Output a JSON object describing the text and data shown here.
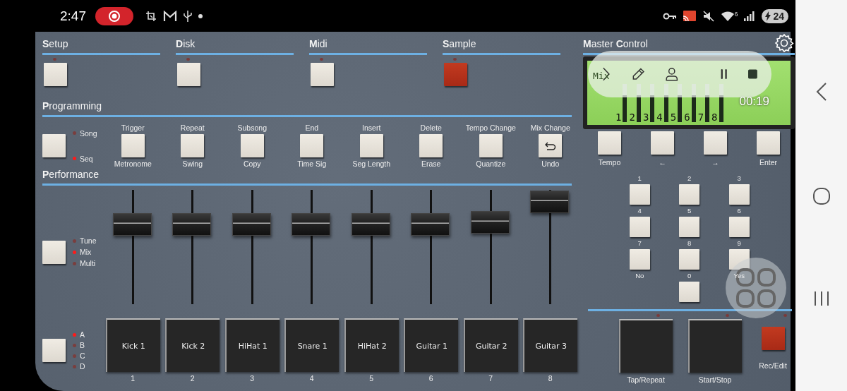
{
  "status_bar": {
    "time": "2:47",
    "wifi_badge": "6",
    "battery": "24"
  },
  "sections": [
    {
      "title": "**S**etup",
      "lit": false
    },
    {
      "title": "**D**isk",
      "lit": false
    },
    {
      "title": "**M**idi",
      "lit": false
    },
    {
      "title": "**S**ample",
      "lit": true
    }
  ],
  "programming": {
    "title": "**P**rogramming",
    "modes": [
      {
        "label": "Song",
        "selected": false
      },
      {
        "label": "Seq",
        "selected": true
      }
    ],
    "buttons": [
      {
        "top": "Trigger",
        "bottom": "Metronome",
        "kind": "plain"
      },
      {
        "top": "Repeat",
        "bottom": "Swing",
        "kind": "plain"
      },
      {
        "top": "Subsong",
        "bottom": "Copy",
        "kind": "plain"
      },
      {
        "top": "End",
        "bottom": "Time Sig",
        "kind": "plain"
      },
      {
        "top": "Insert",
        "bottom": "Seg Length",
        "kind": "plain"
      },
      {
        "top": "Delete",
        "bottom": "Erase",
        "kind": "plain"
      },
      {
        "top": "Tempo Change",
        "bottom": "Quantize",
        "kind": "plain"
      },
      {
        "top": "Mix Change",
        "bottom": "Undo",
        "kind": "undo"
      }
    ]
  },
  "performance": {
    "title": "**P**erformance",
    "modes": [
      {
        "label": "Tune",
        "selected": false
      },
      {
        "label": "Mix",
        "selected": true
      },
      {
        "label": "Multi",
        "selected": false
      }
    ],
    "faders": [
      {
        "level": 0.75
      },
      {
        "level": 0.75
      },
      {
        "level": 0.75
      },
      {
        "level": 0.75
      },
      {
        "level": 0.75
      },
      {
        "level": 0.75
      },
      {
        "level": 0.77
      },
      {
        "level": 0.99
      }
    ],
    "banks": [
      {
        "label": "A",
        "selected": true
      },
      {
        "label": "B",
        "selected": false
      },
      {
        "label": "C",
        "selected": false
      },
      {
        "label": "D",
        "selected": false
      }
    ],
    "pads": [
      {
        "name": "Kick 1",
        "number": "1"
      },
      {
        "name": "Kick 2",
        "number": "2"
      },
      {
        "name": "HiHat 1",
        "number": "3"
      },
      {
        "name": "Snare 1",
        "number": "4"
      },
      {
        "name": "HiHat 2",
        "number": "5"
      },
      {
        "name": "Guitar 1",
        "number": "6"
      },
      {
        "name": "Guitar 2",
        "number": "7"
      },
      {
        "name": "Guitar 3",
        "number": "8"
      }
    ]
  },
  "master_control": {
    "title": "**M**aster **C**ontrol",
    "lcd": {
      "mode": "Mix",
      "channels": [
        "1",
        "2",
        "3",
        "4",
        "5",
        "6",
        "7",
        "8"
      ],
      "time": "00:19"
    },
    "buttons": [
      "Tempo",
      "←",
      "→",
      "Enter"
    ],
    "keypad": {
      "keys": [
        "1",
        "2",
        "3",
        "4",
        "5",
        "6",
        "7",
        "8",
        "9",
        "0"
      ],
      "captions": [
        "No",
        "Yes"
      ]
    },
    "transport": [
      "Tap/Repeat",
      "Start/Stop"
    ],
    "rec": {
      "label": "Rec/Edit",
      "on": true
    }
  }
}
